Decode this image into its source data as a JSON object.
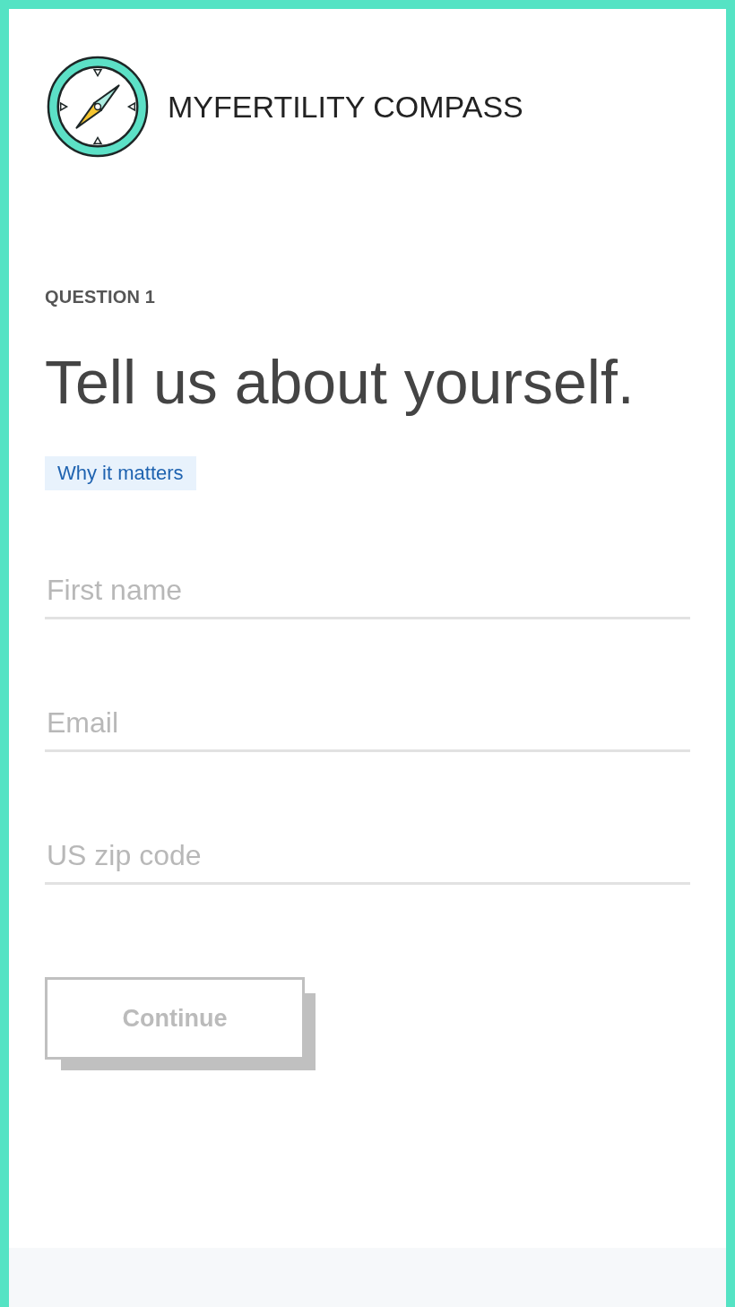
{
  "header": {
    "brand": "MYFERTILITY COMPASS"
  },
  "question": {
    "label": "QUESTION 1",
    "title": "Tell us about yourself.",
    "help_link": "Why it matters"
  },
  "fields": [
    {
      "placeholder": "First name"
    },
    {
      "placeholder": "Email"
    },
    {
      "placeholder": "US zip code"
    }
  ],
  "continue_button": {
    "label": "Continue",
    "disabled": true
  }
}
